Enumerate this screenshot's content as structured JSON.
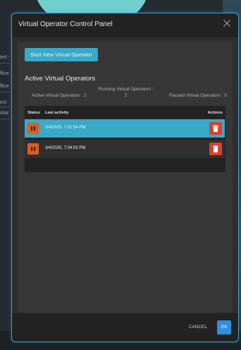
{
  "background": {
    "left_items": [
      "ted -",
      "ffice",
      "ffice",
      "est",
      "Alar"
    ]
  },
  "dialog": {
    "title": "Virtual Operator Control Panel",
    "close_icon": "close-icon",
    "start_button_label": "Start New Virtual Operator",
    "section_title": "Active Virtual Operators",
    "stats": {
      "running_label": "Running Virtual Operators :",
      "running_value": "2",
      "active_text": "Active Virtual Operators : 2",
      "paused_text": "Paused Virtual Operators : 0"
    },
    "table": {
      "columns": {
        "status": "Status",
        "last_activity": "Last activity",
        "actions": "Actions"
      },
      "rows": [
        {
          "last_activity": "3/4/2025, 7:01:54 PM",
          "selected": true,
          "status_icon": "pause-icon",
          "action_icon": "trash-icon"
        },
        {
          "last_activity": "3/4/2025, 7:04:53 PM",
          "selected": false,
          "status_icon": "pause-icon",
          "action_icon": "trash-icon"
        }
      ]
    },
    "footer": {
      "cancel_label": "CANCEL",
      "ok_label": "OK"
    }
  },
  "colors": {
    "accent_teal": "#3aa8c7",
    "border_blue": "#3aa0d8",
    "pause_orange": "#e35b18",
    "delete_red": "#d8412f",
    "ok_blue": "#2e8fe0"
  }
}
